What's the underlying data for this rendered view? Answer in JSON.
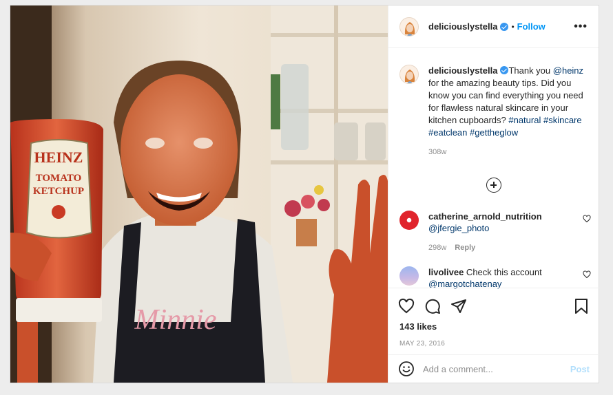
{
  "post": {
    "username": "deliciouslystella",
    "follow_label": "Follow",
    "separator": "•",
    "more_label": "•••"
  },
  "photo": {
    "bottle_brand": "HEINZ",
    "bottle_line1": "TOMATO",
    "bottle_line2": "KETCHUP",
    "shirt_text": "Minnie"
  },
  "caption": {
    "username": "deliciouslystella",
    "text_1": "Thank you ",
    "mention": "@heinz",
    "text_2": " for the amazing beauty tips. Did you know you can find everything you need for flawless natural skincare in your kitchen cupboards? ",
    "tag_1": "#natural",
    "tag_2": "#skincare",
    "tag_3": "#eatclean",
    "tag_4": "#gettheglow",
    "time": "308w"
  },
  "comments": [
    {
      "username": "catherine_arnold_nutrition",
      "text": "",
      "mention": "@jfergie_photo",
      "time": "298w",
      "reply_label": "Reply"
    },
    {
      "username": "livolivee",
      "text": " Check this account ",
      "mention": "@margotchatenay"
    }
  ],
  "stats": {
    "likes": "143 likes",
    "date": "MAY 23, 2016"
  },
  "add_comment": {
    "placeholder": "Add a comment...",
    "post_label": "Post"
  }
}
